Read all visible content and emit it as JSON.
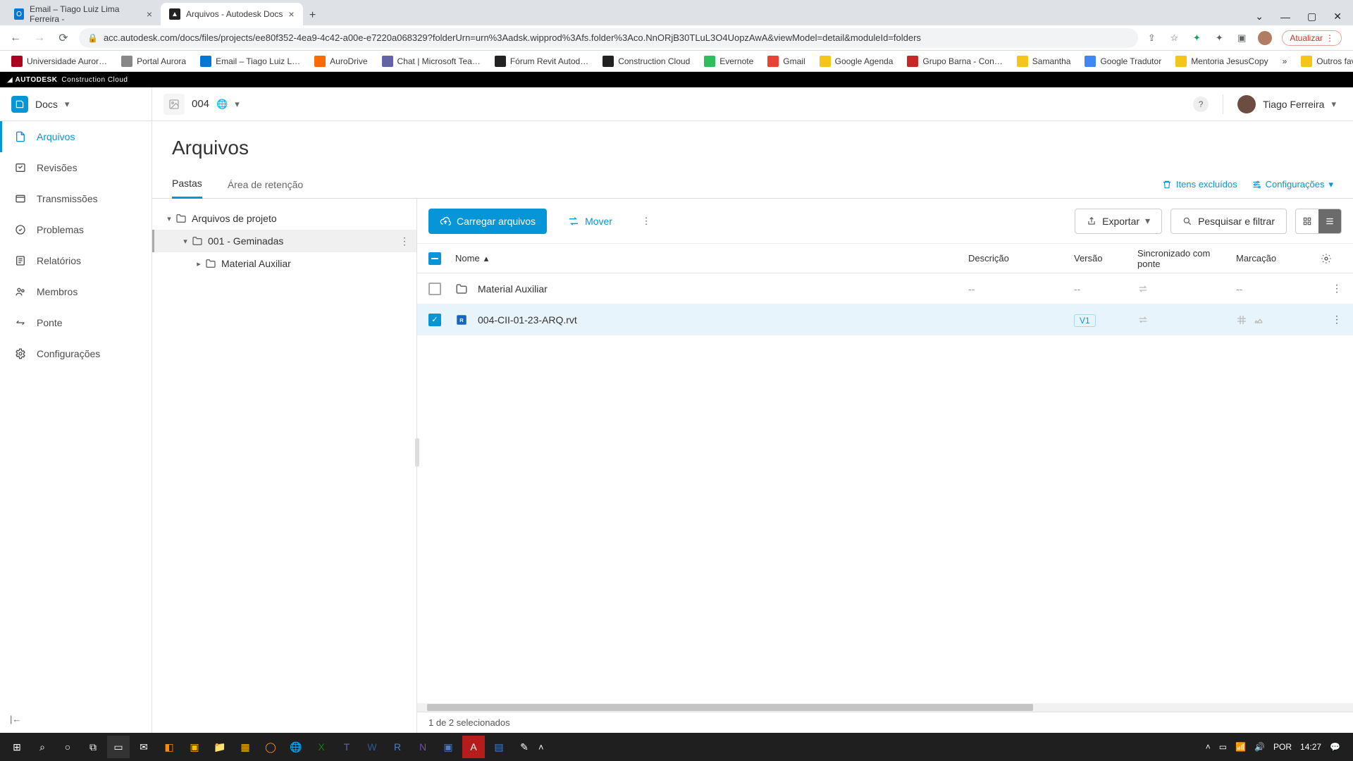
{
  "browser": {
    "tabs": [
      {
        "title": "Email – Tiago Luiz Lima Ferreira -",
        "active": false
      },
      {
        "title": "Arquivos - Autodesk Docs",
        "active": true
      }
    ],
    "url": "acc.autodesk.com/docs/files/projects/ee80f352-4ea9-4c42-a00e-e7220a068329?folderUrn=urn%3Aadsk.wipprod%3Afs.folder%3Aco.NnORjB30TLuL3O4UopzAwA&viewModel=detail&moduleId=folders",
    "update_label": "Atualizar",
    "bookmarks": [
      "Universidade Auror…",
      "Portal Aurora",
      "Email – Tiago Luiz L…",
      "AuroDrive",
      "Chat | Microsoft Tea…",
      "Fórum Revit Autod…",
      "Construction Cloud",
      "Evernote",
      "Gmail",
      "Google Agenda",
      "Grupo Barna - Con…",
      "Samantha",
      "Google Tradutor",
      "Mentoria JesusCopy"
    ],
    "other_bookmarks": "Outros favoritos"
  },
  "autodesk_bar": {
    "brand": "AUTODESK",
    "product": "Construction Cloud"
  },
  "header": {
    "module": "Docs",
    "project": "004",
    "user": "Tiago Ferreira"
  },
  "sidebar": {
    "items": [
      {
        "label": "Arquivos",
        "active": true
      },
      {
        "label": "Revisões"
      },
      {
        "label": "Transmissões"
      },
      {
        "label": "Problemas"
      },
      {
        "label": "Relatórios"
      },
      {
        "label": "Membros"
      },
      {
        "label": "Ponte"
      },
      {
        "label": "Configurações"
      }
    ]
  },
  "page": {
    "title": "Arquivos",
    "tabs": {
      "folders": "Pastas",
      "holding": "Área de retenção"
    },
    "links": {
      "deleted": "Itens excluídos",
      "settings": "Configurações"
    }
  },
  "tree": {
    "root": "Arquivos de projeto",
    "item1": "001 - Geminadas",
    "item2": "Material Auxiliar"
  },
  "toolbar": {
    "upload": "Carregar arquivos",
    "move": "Mover",
    "export": "Exportar",
    "search": "Pesquisar e filtrar"
  },
  "table": {
    "headers": {
      "name": "Nome",
      "desc": "Descrição",
      "ver": "Versão",
      "sync": "Sincronizado com ponte",
      "mark": "Marcação"
    },
    "rows": [
      {
        "name": "Material Auxiliar",
        "type": "folder",
        "desc": "--",
        "ver": "--",
        "mark": "--",
        "checked": false
      },
      {
        "name": "004-CII-01-23-ARQ.rvt",
        "type": "rvt",
        "desc": "",
        "ver": "V1",
        "mark": "",
        "checked": true
      }
    ],
    "status": "1 de 2 selecionados"
  },
  "system": {
    "lang": "POR",
    "time": "14:27"
  }
}
